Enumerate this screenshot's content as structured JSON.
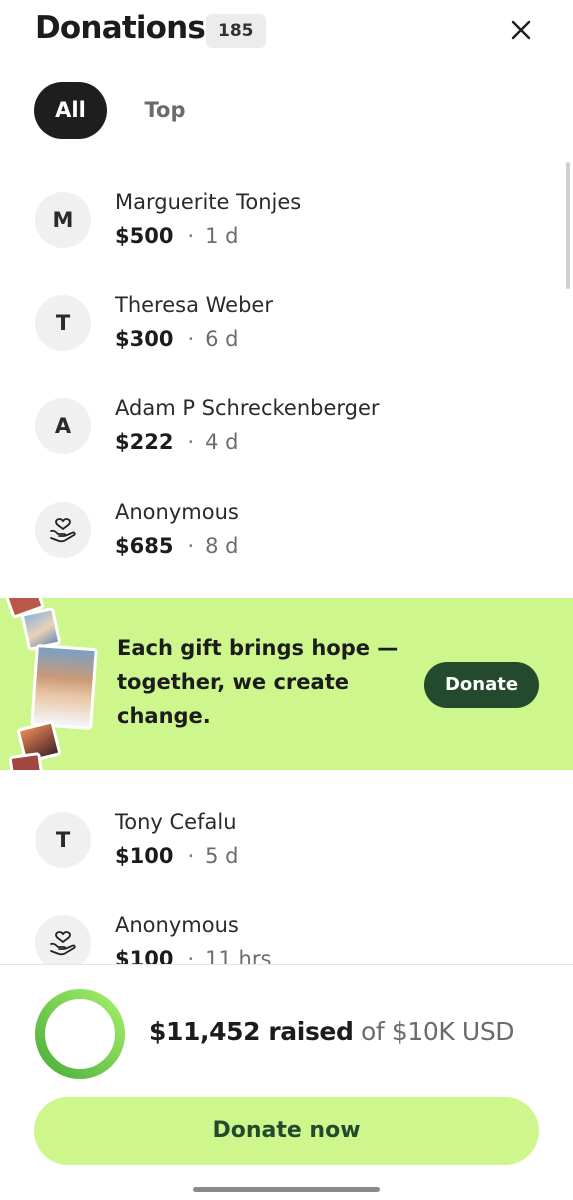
{
  "header": {
    "title": "Donations",
    "count": "185",
    "close_icon": "close-icon"
  },
  "tabs": [
    {
      "label": "All",
      "selected": true
    },
    {
      "label": "Top",
      "selected": false
    }
  ],
  "donations": [
    {
      "initial": "M",
      "name": "Marguerite Tonjes",
      "amount": "$500",
      "separator": "·",
      "time": "1 d"
    },
    {
      "initial": "T",
      "name": "Theresa Weber",
      "amount": "$300",
      "separator": "·",
      "time": "6 d"
    },
    {
      "initial": "A",
      "name": "Adam P Schreckenberger",
      "amount": "$222",
      "separator": "·",
      "time": "4 d"
    },
    {
      "initial": "",
      "icon": "heart-hand-icon",
      "name": "Anonymous",
      "amount": "$685",
      "separator": "·",
      "time": "8 d"
    },
    {
      "initial": "T",
      "name": "Tony Cefalu",
      "amount": "$100",
      "separator": "·",
      "time": "5 d"
    },
    {
      "initial": "",
      "icon": "heart-hand-icon",
      "name": "Anonymous",
      "amount": "$100",
      "separator": "·",
      "time": "11 hrs"
    }
  ],
  "promo": {
    "text": "Each gift brings hope — together, we create change.",
    "button_label": "Donate",
    "background": "#cdf68c",
    "button_color": "#234a2c"
  },
  "progress": {
    "raised_amount": "$11,452 raised",
    "goal_text": "of $10K USD",
    "fraction": 1.0,
    "ring_color": "#6ac04a"
  },
  "cta": {
    "label": "Donate now"
  }
}
